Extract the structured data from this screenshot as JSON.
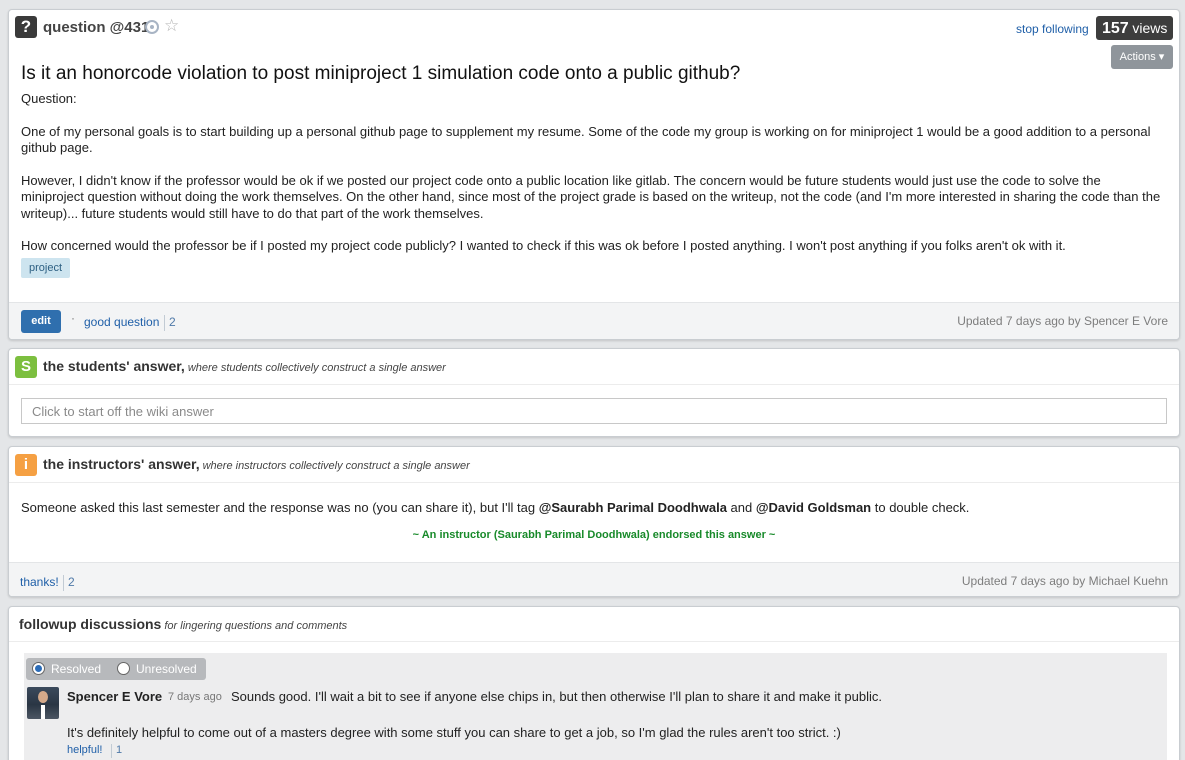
{
  "question": {
    "label": "question @431",
    "stop_following": "stop following",
    "views_count": "157",
    "views_word": "views",
    "actions_label": "Actions",
    "title": "Is it an honorcode violation to post miniproject 1 simulation code onto a public github?",
    "body": [
      "Question:",
      "One of my personal goals is to start building up a personal github page to supplement my resume.  Some of the code my group is working on for miniproject 1 would be a good addition to a personal github page.",
      "However, I didn't know if the professor would be ok if we posted our project code onto a public location like gitlab.  The concern would be future students would just use the code to solve the miniproject question without doing the work themselves. On the other hand, since most of the project grade is based on the writeup, not the code (and I'm more interested in sharing the code than the writeup)... future students would still have to do that part of the work themselves.",
      "How concerned would the professor be if I posted my project code publicly? I wanted to check if this was ok before I posted anything. I won't post anything if you folks aren't ok with it."
    ],
    "tag": "project",
    "edit_label": "edit",
    "good_question_label": "good question",
    "good_question_count": "2",
    "updated": "Updated 7 days ago by Spencer E Vore"
  },
  "students_answer": {
    "icon_letter": "S",
    "icon_color": "#7cbf3f",
    "title": "the students' answer,",
    "subtitle": "where students collectively construct a single answer",
    "placeholder": "Click to start off the wiki answer"
  },
  "instructors_answer": {
    "icon_letter": "i",
    "icon_color": "#f5a043",
    "title": "the instructors' answer,",
    "subtitle": "where instructors collectively construct a single answer",
    "body_before": "Someone asked this last semester and the response was no (you can share it), but I'll tag ",
    "mention1": "@Saurabh Parimal Doodhwala",
    "body_between": " and ",
    "mention2": "@David Goldsman",
    "body_after": " to double check.",
    "endorsement": "~ An instructor (Saurabh Parimal Doodhwala) endorsed this answer  ~",
    "thanks_label": "thanks!",
    "thanks_count": "2",
    "updated": "Updated 7 days ago by Michael Kuehn"
  },
  "followup": {
    "title": "followup discussions",
    "subtitle": "for lingering questions and comments",
    "resolved_label": "Resolved",
    "unresolved_label": "Unresolved",
    "author": "Spencer E Vore",
    "time": "7 days ago",
    "message1": "Sounds good. I'll wait a bit to see if anyone else chips in, but then otherwise I'll plan to share it and make it public.",
    "message2": "It's definitely helpful to come out of a masters degree with some stuff you can share to get a job, so I'm glad the rules aren't too strict. :)",
    "helpful_label": "helpful!",
    "helpful_count": "1"
  }
}
